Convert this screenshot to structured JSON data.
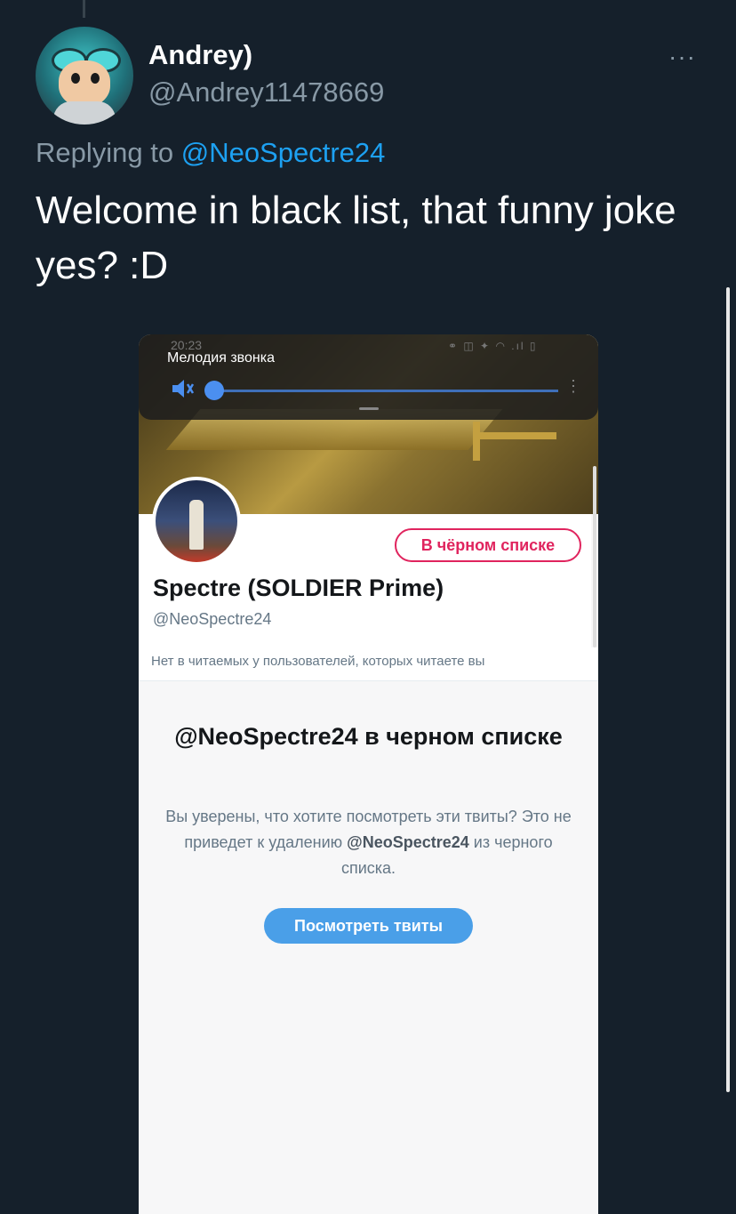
{
  "tweet": {
    "author_name": "Andrey)",
    "author_handle": "@Andrey11478669",
    "more_label": "···",
    "replying_prefix": "Replying to",
    "replying_handle": "@NeoSpectre24",
    "text": "Welcome in black list, that funny joke yes? :D"
  },
  "screenshot": {
    "status_time": "20:23",
    "status_icons": "⚭ ◫ ✦ ◠ .ıl ▯",
    "volume_label": "Мелодия звонка",
    "volume_level": 0,
    "profile": {
      "name": "Spectre (SOLDIER Prime)",
      "handle": "@NeoSpectre24",
      "blocked_button": "В чёрном списке",
      "followers_note": "Нет в читаемых у пользователей, которых читаете вы"
    },
    "notice": {
      "title": "@NeoSpectre24 в черном списке",
      "body_before": "Вы уверены, что хотите посмотреть эти твиты? Это не приведет к удалению",
      "body_handle": "@NeoSpectre24",
      "body_after": "из черного списка.",
      "button": "Посмотреть твиты"
    }
  },
  "colors": {
    "background": "#15202b",
    "muted": "#8899a6",
    "link": "#1da1f2",
    "blocked": "#e0245e",
    "button": "#4a9fe8"
  },
  "icons": [
    "more-icon",
    "mute-icon",
    "kebab-icon"
  ]
}
